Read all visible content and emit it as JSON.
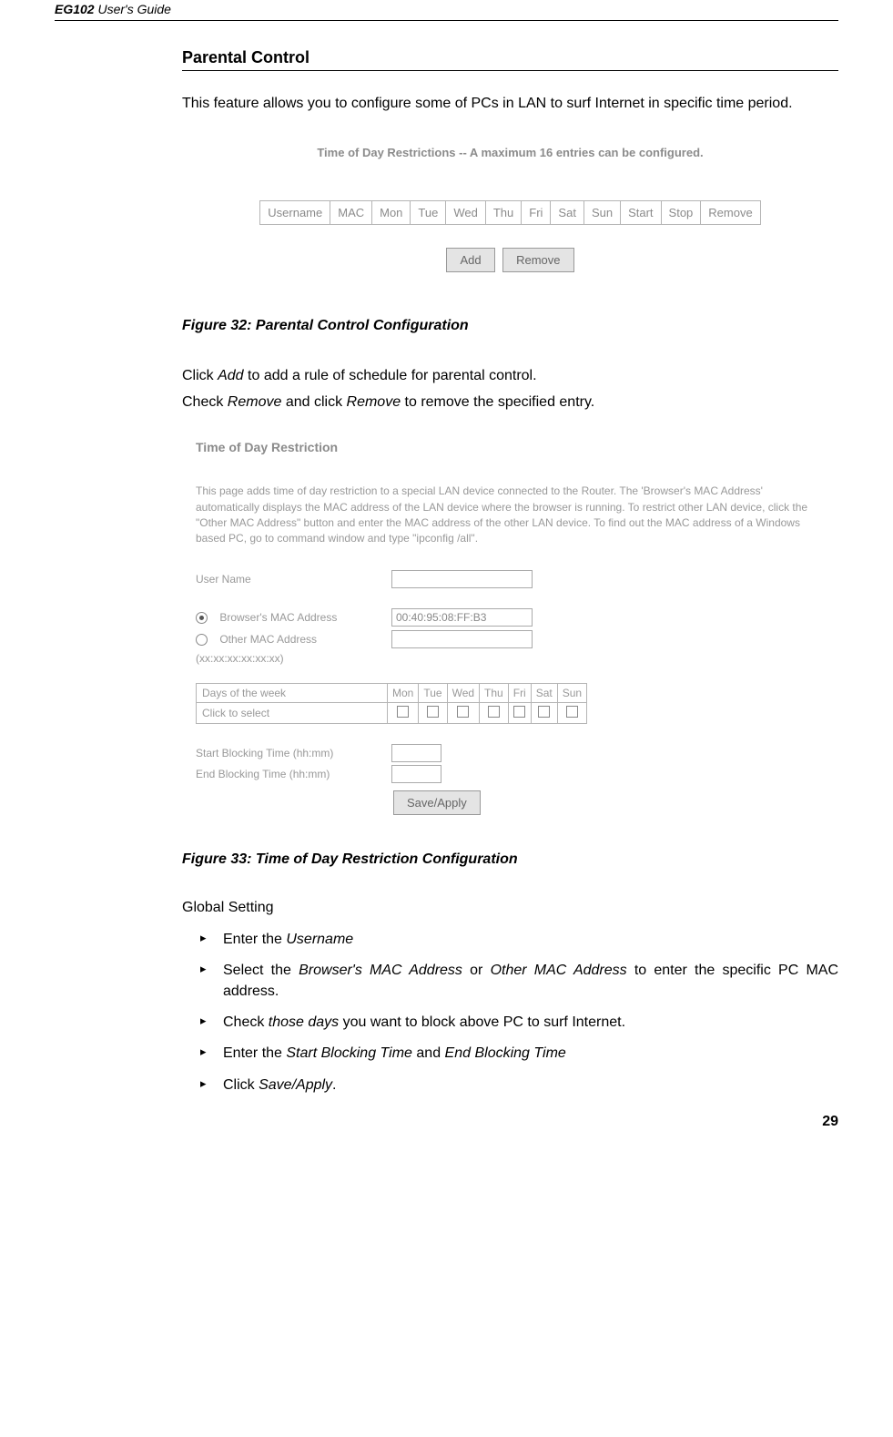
{
  "header": {
    "product": "EG102",
    "suffix": " User's Guide"
  },
  "section_title": "Parental Control",
  "intro": "This feature allows you to configure some of PCs in LAN to surf Internet in specific time period.",
  "shot1": {
    "title": "Time of Day Restrictions -- A maximum 16 entries can be configured.",
    "cols": [
      "Username",
      "MAC",
      "Mon",
      "Tue",
      "Wed",
      "Thu",
      "Fri",
      "Sat",
      "Sun",
      "Start",
      "Stop",
      "Remove"
    ],
    "btn_add": "Add",
    "btn_remove": "Remove"
  },
  "fig32": "Figure 32: Parental Control Configuration",
  "mid": {
    "line1_pre": "Click ",
    "line1_em": "Add",
    "line1_post": " to add a rule of schedule for parental control.",
    "line2_pre": "Check ",
    "line2_em1": "Remove",
    "line2_mid": " and click ",
    "line2_em2": "Remove",
    "line2_post": " to remove the specified entry."
  },
  "shot2": {
    "title": "Time of Day Restriction",
    "para": "This page adds time of day restriction to a special LAN device connected to the Router. The 'Browser's MAC Address' automatically displays the MAC address of the LAN device where the browser is running. To restrict other LAN device, click the \"Other MAC Address\" button and enter the MAC address of the other LAN device. To find out the MAC address of a Windows based PC, go to command window and type \"ipconfig /all\".",
    "label_user": "User Name",
    "label_browser": "Browser's MAC Address",
    "val_browser": "00:40:95:08:FF:B3",
    "label_other": "Other MAC Address",
    "label_other_hint": "(xx:xx:xx:xx:xx:xx)",
    "dow_label": "Days of the week",
    "click_label": "Click to select",
    "days": [
      "Mon",
      "Tue",
      "Wed",
      "Thu",
      "Fri",
      "Sat",
      "Sun"
    ],
    "label_start": "Start Blocking Time (hh:mm)",
    "label_end": "End Blocking Time (hh:mm)",
    "btn_save": "Save/Apply"
  },
  "fig33": "Figure 33: Time of Day Restriction Configuration",
  "global_heading": "Global Setting",
  "bullets": {
    "b1_pre": "Enter the ",
    "b1_em": "Username",
    "b2_pre": "Select the ",
    "b2_em1": "Browser's MAC Address",
    "b2_mid": " or ",
    "b2_em2": "Other MAC Address",
    "b2_post": " to enter the specific PC MAC address.",
    "b3_pre": "Check ",
    "b3_em": "those days",
    "b3_post": " you want to block above PC to surf Internet.",
    "b4_pre": "Enter the ",
    "b4_em1": "Start Blocking Time",
    "b4_mid": " and ",
    "b4_em2": "End Blocking Time",
    "b5_pre": "Click ",
    "b5_em": "Save/Apply",
    "b5_post": "."
  },
  "page_number": "29"
}
